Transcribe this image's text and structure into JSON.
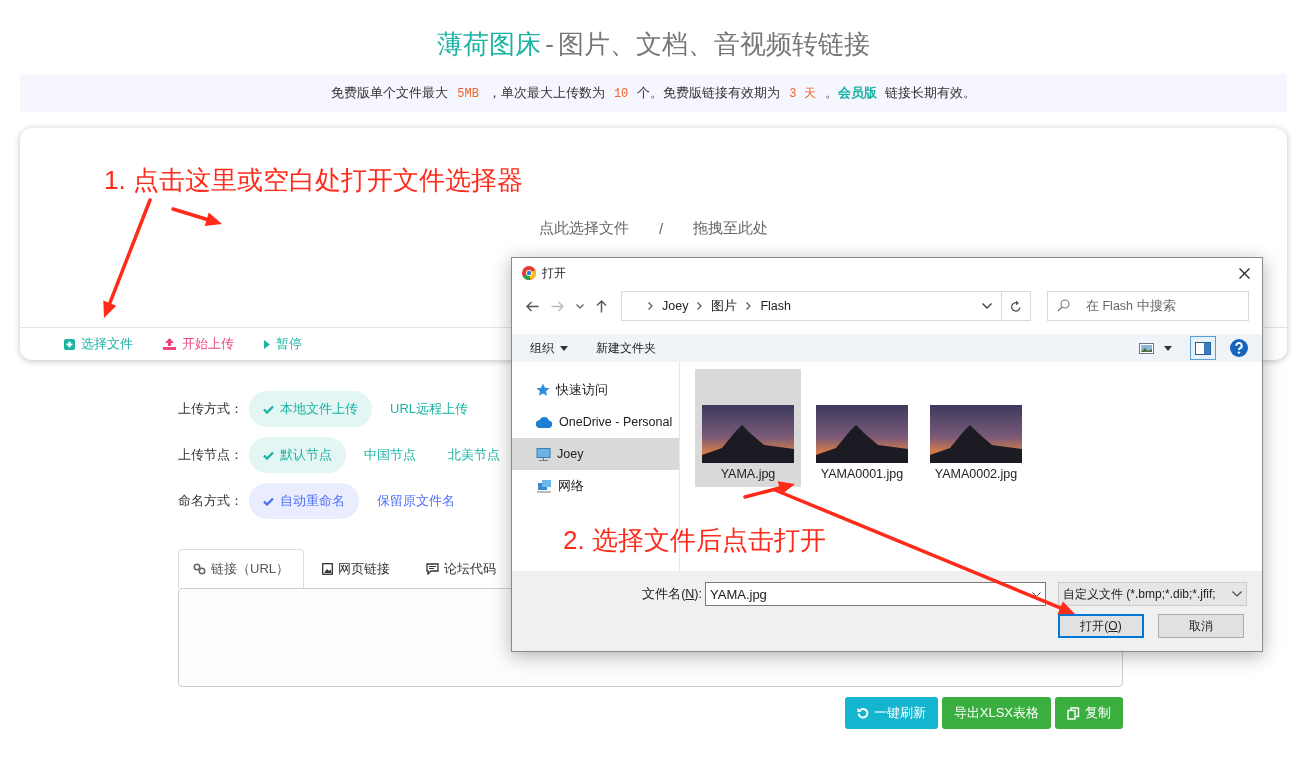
{
  "header": {
    "brand": "薄荷图床",
    "separator": "-",
    "subtitle": "图片、文档、音视频转链接"
  },
  "notice": [
    {
      "kind": "text",
      "text": "免费版单个文件最大"
    },
    {
      "kind": "code",
      "text": "5MB"
    },
    {
      "kind": "text",
      "text": "，单次最大上传数为"
    },
    {
      "kind": "code",
      "text": "10"
    },
    {
      "kind": "text",
      "text": "个。免费版链接有效期为"
    },
    {
      "kind": "code",
      "text": "3 天"
    },
    {
      "kind": "text",
      "text": "。"
    },
    {
      "kind": "link",
      "text": "会员版"
    },
    {
      "kind": "text",
      "text": "链接长期有效。"
    }
  ],
  "upload": {
    "prompt": "点此选择文件",
    "divider": "/",
    "drop_hint": "拖拽至此处",
    "actions": [
      {
        "kind": "select",
        "label": "选择文件"
      },
      {
        "kind": "upload",
        "label": "开始上传"
      },
      {
        "kind": "pause",
        "label": "暂停"
      }
    ]
  },
  "options": [
    {
      "label": "上传方式：",
      "color": "#1ab3a3",
      "choices": [
        {
          "label": "本地文件上传",
          "selected": true
        },
        {
          "label": "URL远程上传",
          "selected": false
        }
      ]
    },
    {
      "label": "上传节点：",
      "color": "#1ab3a3",
      "choices": [
        {
          "label": "默认节点",
          "selected": true
        },
        {
          "label": "中国节点",
          "selected": false
        },
        {
          "label": "北美节点",
          "selected": false
        }
      ]
    },
    {
      "label": "命名方式：",
      "color": "#4f6ef7",
      "choices": [
        {
          "label": "自动重命名",
          "selected": true
        },
        {
          "label": "保留原文件名",
          "selected": false
        }
      ]
    }
  ],
  "result_tabs": [
    {
      "kind": "link",
      "label": "链接（URL）",
      "selected": true
    },
    {
      "kind": "web",
      "label": "网页链接",
      "selected": false
    },
    {
      "kind": "forum",
      "label": "论坛代码",
      "selected": false
    }
  ],
  "result_buttons": [
    {
      "kind": "refresh",
      "label": "一键刷新",
      "color": "#14b6cf"
    },
    {
      "kind": "export",
      "label": "导出XLSX表格",
      "color": "#3aae3e"
    },
    {
      "kind": "copy",
      "label": "复制",
      "color": "#3aae3e"
    }
  ],
  "dialog": {
    "title": "打开",
    "path": [
      "Joey",
      "图片",
      "Flash"
    ],
    "search": {
      "placeholder": "在 Flash 中搜索"
    },
    "toolbar": [
      {
        "kind": "menu",
        "label": "组织"
      },
      {
        "kind": "button",
        "label": "新建文件夹"
      }
    ],
    "nav": [
      {
        "kind": "star",
        "label": "快速访问",
        "selected": false
      },
      {
        "kind": "cloud",
        "label": "OneDrive - Personal",
        "selected": false
      },
      {
        "kind": "computer",
        "label": "Joey",
        "selected": true
      },
      {
        "kind": "network",
        "label": "网络",
        "selected": false
      }
    ],
    "files": [
      {
        "name": "YAMA.jpg",
        "selected": true
      },
      {
        "name": "YAMA0001.jpg",
        "selected": false
      },
      {
        "name": "YAMA0002.jpg",
        "selected": false
      }
    ],
    "filename": {
      "label_start": "文件名(",
      "access_key": "N",
      "label_end": "):",
      "value": "YAMA.jpg"
    },
    "filter": "自定义文件 (*.bmp;*.dib;*.jfif;",
    "buttons": [
      {
        "kind": "default",
        "label_start": "打开(",
        "access_key": "O",
        "label_end": ")"
      },
      {
        "kind": "plain",
        "label": "取消"
      }
    ]
  },
  "annotations": [
    {
      "text": "1. 点击这里或空白处打开文件选择器"
    },
    {
      "text": "2. 选择文件后点击打开"
    }
  ]
}
